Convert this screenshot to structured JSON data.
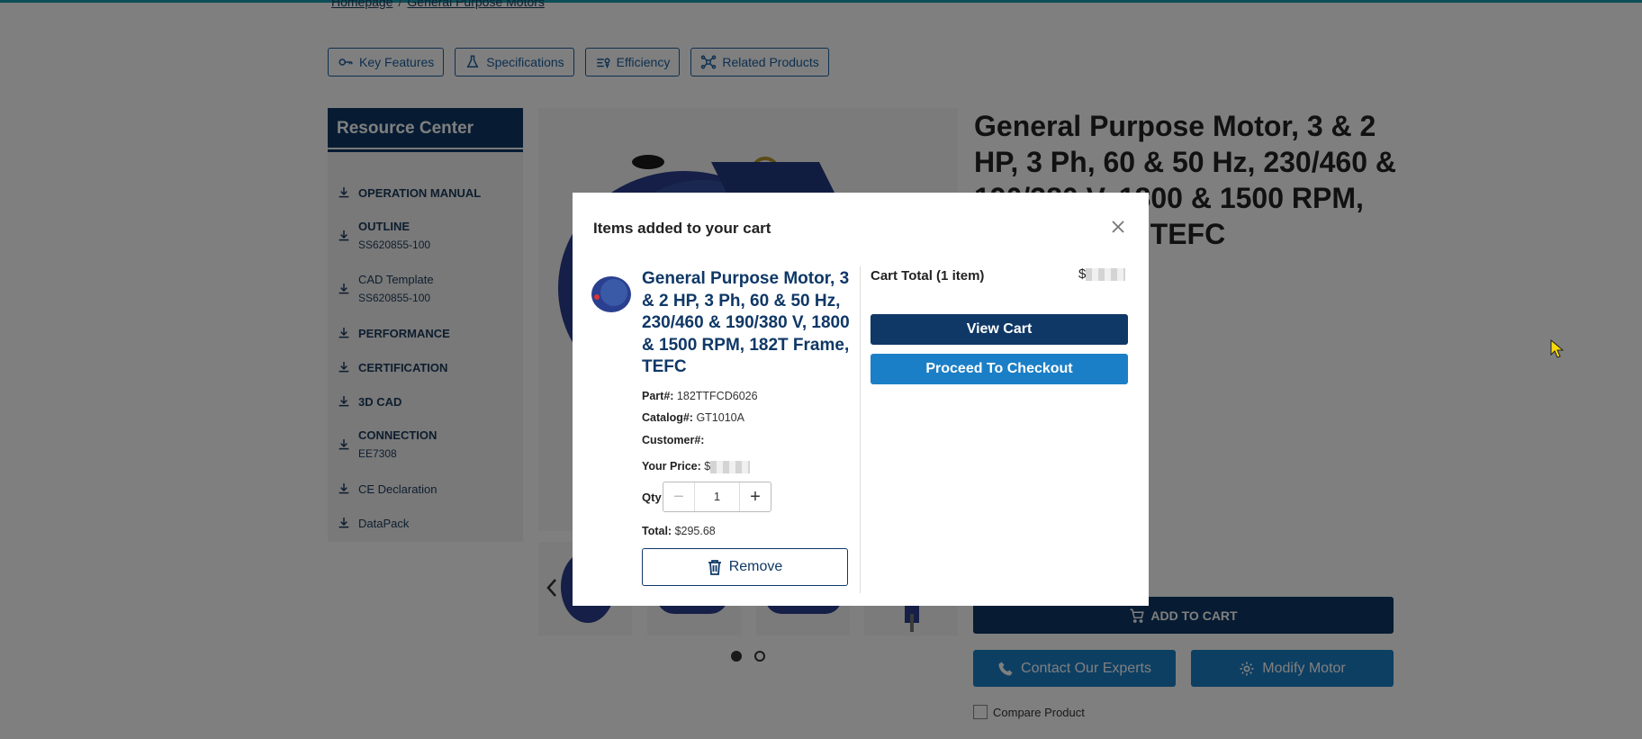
{
  "breadcrumb": {
    "home": "Homepage",
    "separator": "/",
    "current": "General Purpose Motors"
  },
  "tabs": [
    {
      "label": "Key Features",
      "icon": "key-icon"
    },
    {
      "label": "Specifications",
      "icon": "flask-icon"
    },
    {
      "label": "Efficiency",
      "icon": "efficiency-icon"
    },
    {
      "label": "Related Products",
      "icon": "network-icon"
    }
  ],
  "resource_center": {
    "title": "Resource Center",
    "items": [
      {
        "label": "OPERATION MANUAL",
        "sub": ""
      },
      {
        "label": "OUTLINE",
        "sub": "SS620855-100"
      },
      {
        "label": "CAD Template",
        "sub": "SS620855-100"
      },
      {
        "label": "PERFORMANCE",
        "sub": ""
      },
      {
        "label": "CERTIFICATION",
        "sub": ""
      },
      {
        "label": "3D CAD",
        "sub": ""
      },
      {
        "label": "CONNECTION",
        "sub": "EE7308"
      },
      {
        "label": "CE Declaration",
        "sub": ""
      },
      {
        "label": "DataPack",
        "sub": ""
      }
    ]
  },
  "product": {
    "title": "General Purpose Motor, 3 & 2 HP, 3 Ph, 60 & 50 Hz, 230/460 & 190/380 V, 1800 & 1500 RPM, 182T Frame, TEFC"
  },
  "actions": {
    "add_to_cart": "ADD TO CART",
    "contact": "Contact Our Experts",
    "modify": "Modify Motor",
    "compare": "Compare Product"
  },
  "modal": {
    "title": "Items added to your cart",
    "item_title": "General Purpose Motor, 3 & 2 HP, 3 Ph, 60 & 50 Hz, 230/460 & 190/380 V, 1800 & 1500 RPM, 182T Frame, TEFC",
    "part_label": "Part#:",
    "part_value": "182TTFCD6026",
    "catalog_label": "Catalog#:",
    "catalog_value": "GT1010A",
    "customer_label": "Customer#:",
    "price_label": "Your Price:",
    "price_prefix": "$",
    "qty_label": "Qty",
    "qty_value": "1",
    "total_label": "Total:",
    "total_value": "$295.68",
    "remove_label": "Remove",
    "cart_total_label": "Cart Total (1 item)",
    "cart_total_prefix": "$",
    "view_cart": "View Cart",
    "checkout": "Proceed To Checkout"
  },
  "colors": {
    "navy": "#0f3866",
    "blue": "#1b7fc7",
    "teal_topline": "#1a9fb0"
  }
}
